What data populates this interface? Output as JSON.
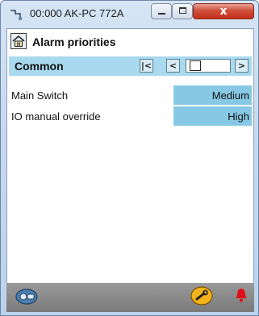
{
  "window": {
    "title": "00:000 AK-PC 772A",
    "close_glyph": "x"
  },
  "header": {
    "title": "Alarm priorities"
  },
  "section": {
    "label": "Common",
    "nav_first": "|<",
    "nav_prev": "<",
    "nav_next": ">"
  },
  "rows": [
    {
      "label": "Main Switch",
      "value": "Medium"
    },
    {
      "label": "IO manual override",
      "value": "High"
    }
  ],
  "footer": {
    "icons": [
      "controller-icon",
      "wrench-icon",
      "alarm-bell-icon"
    ]
  },
  "colors": {
    "section_bg": "#a9d9ee",
    "value_bg": "#87c9e5",
    "alarm": "#e0101a",
    "wrench": "#f2b21c"
  }
}
